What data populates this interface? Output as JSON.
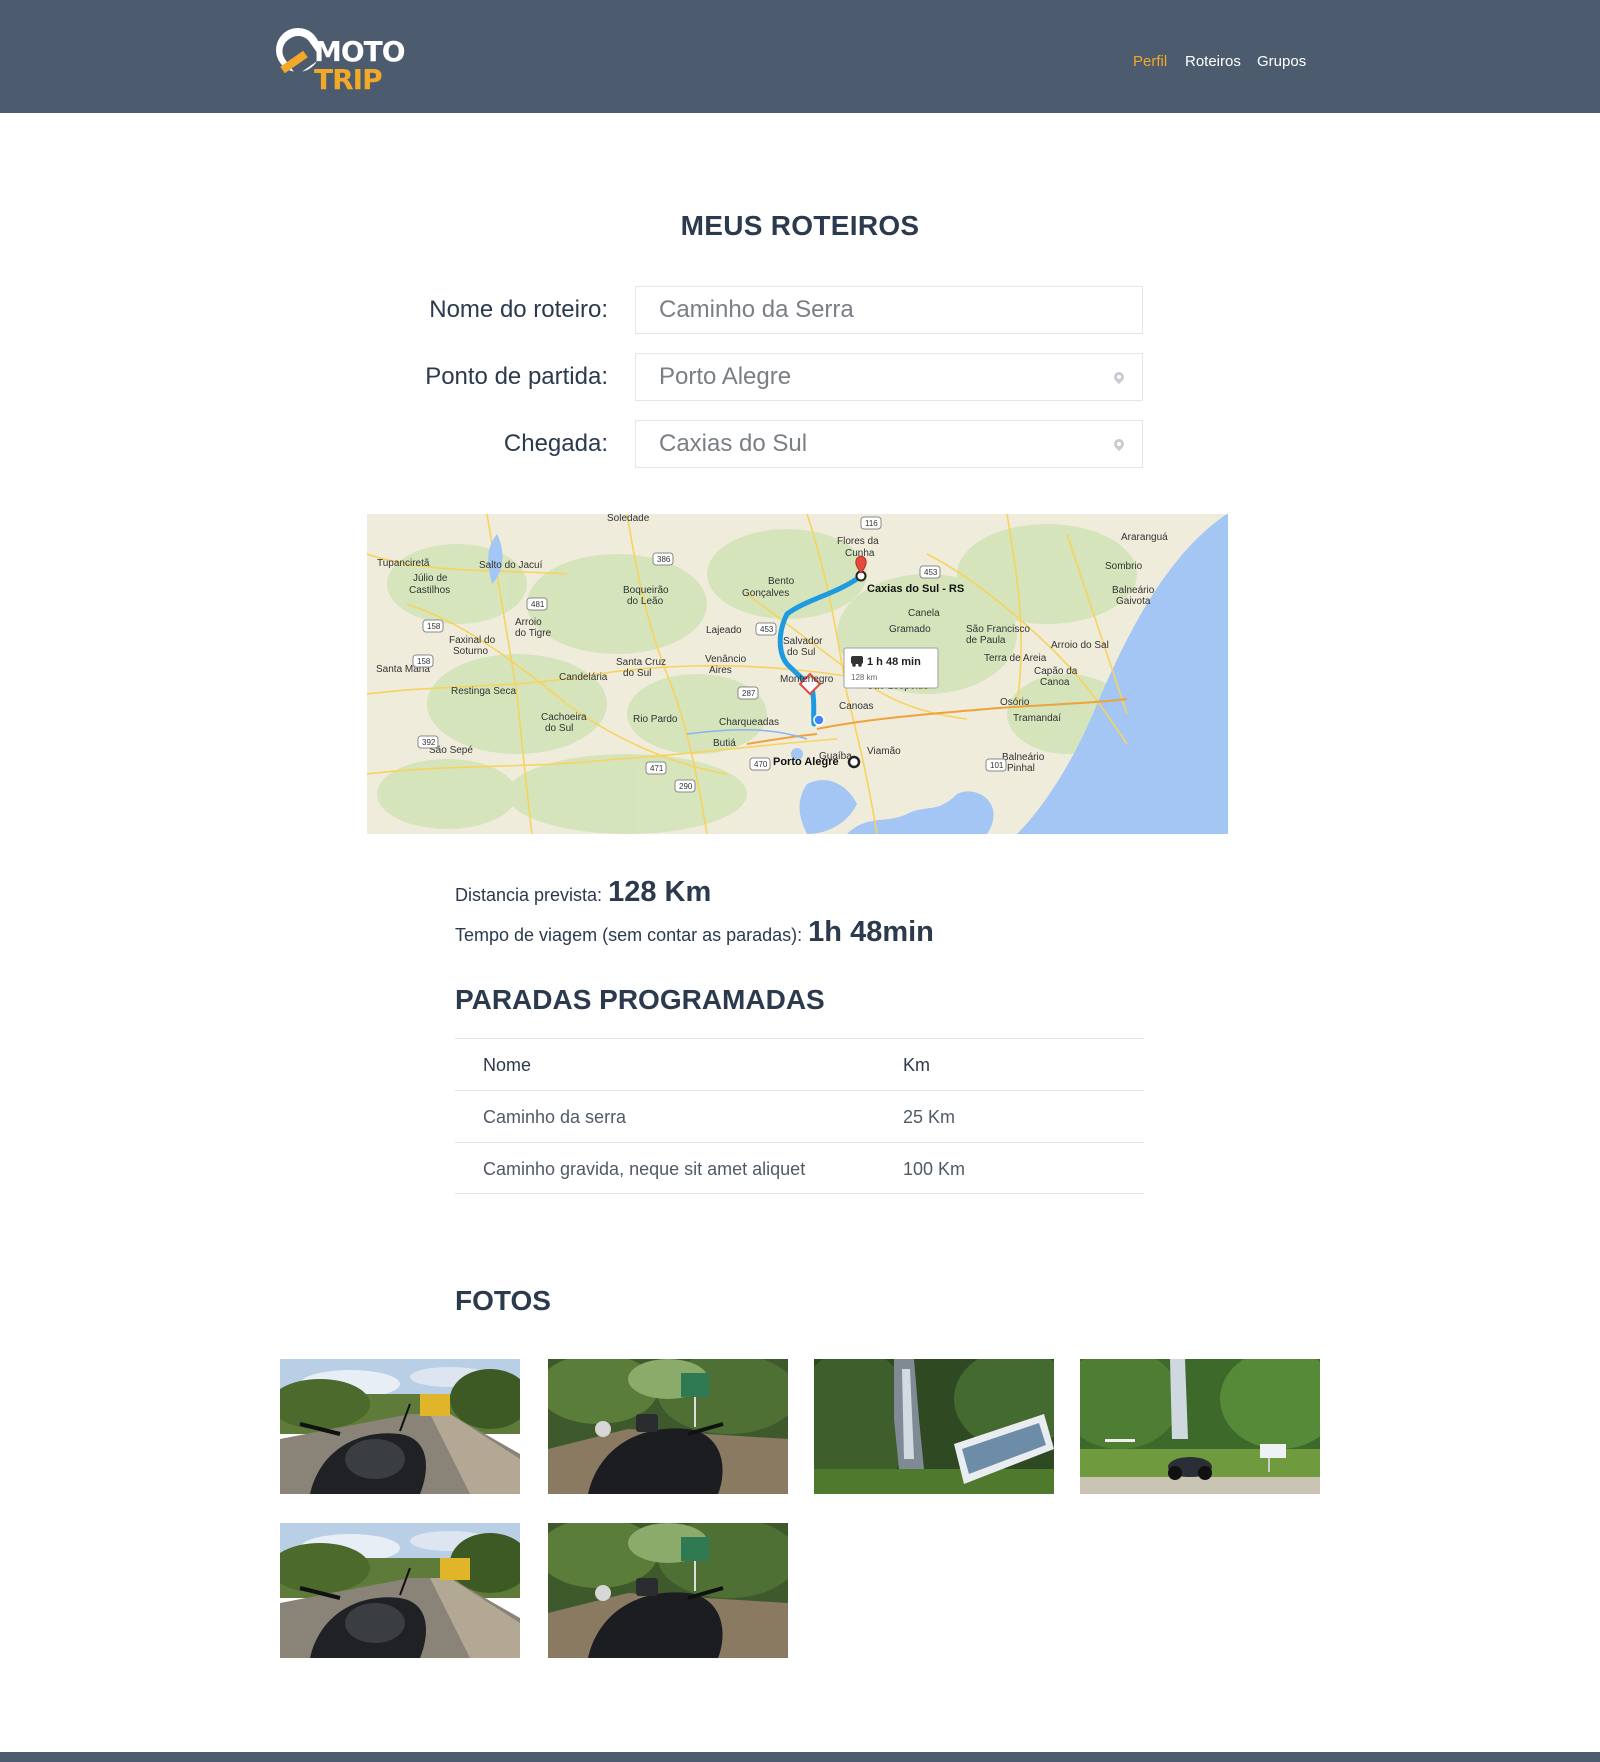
{
  "header": {
    "logo_top": "MOTO",
    "logo_bottom": "TRIP",
    "nav": [
      {
        "label": "Perfil",
        "active": true
      },
      {
        "label": "Roteiros",
        "active": false
      },
      {
        "label": "Grupos",
        "active": false
      }
    ]
  },
  "page_title": "MEUS ROTEIROS",
  "form": {
    "route_name_label": "Nome do roteiro:",
    "route_name_value": "Caminho da Serra",
    "start_label": "Ponto de partida:",
    "start_value": "Porto Alegre",
    "end_label": "Chegada:",
    "end_value": "Caxias do Sul"
  },
  "map": {
    "destination_label": "Caxias do Sul - RS",
    "origin_label": "Porto Alegre",
    "route_duration": "1 h 48 min",
    "route_distance": "128 km",
    "places": [
      "Soledade",
      "Flores da Cunha",
      "Araranguá",
      "Tupanciretã",
      "Salto do Jacuí",
      "Júlio de Castilhos",
      "Bento Gonçalves",
      "Boqueirão do Leão",
      "Sombrio",
      "Balneário Gaivota",
      "Canela",
      "Gramado",
      "São Francisco de Paula",
      "Arroio do Tigre",
      "Lajeado",
      "Salvador do Sul",
      "Faxinal do Soturno",
      "Santa Cruz do Sul",
      "Venâncio Aires",
      "Terra de Areia",
      "Arroio do Sal",
      "Santa Maria",
      "Candelária",
      "Montenegro",
      "Capão da Canoa",
      "Restinga Seca",
      "São Leopoldo",
      "Canoas",
      "Osório",
      "Cachoeira do Sul",
      "Rio Pardo",
      "Charqueadas",
      "Tramandaí",
      "Butiá",
      "Viamão",
      "Guaíba",
      "São Sepé",
      "Balneário Pinhal"
    ],
    "road_numbers": [
      "116",
      "386",
      "453",
      "481",
      "158",
      "453",
      "158",
      "287",
      "392",
      "471",
      "470",
      "290",
      "101"
    ]
  },
  "stats": {
    "distance_label": "Distancia prevista:",
    "distance_value": "128 Km",
    "time_label": "Tempo de viagem (sem contar as paradas):",
    "time_value": "1h 48min"
  },
  "stops": {
    "title": "PARADAS PROGRAMADAS",
    "columns": [
      "Nome",
      "Km"
    ],
    "rows": [
      {
        "name": "Caminho da serra",
        "km": "25 Km"
      },
      {
        "name": "Caminho gravida, neque sit amet aliquet",
        "km": "100 Km"
      }
    ]
  },
  "photos": {
    "title": "FOTOS",
    "items": [
      {
        "scene": "motorcycle-road"
      },
      {
        "scene": "motorcycle-forest-sign"
      },
      {
        "scene": "waterfall-sign"
      },
      {
        "scene": "waterfall-motorcycle"
      },
      {
        "scene": "motorcycle-road"
      },
      {
        "scene": "motorcycle-forest-sign"
      }
    ]
  },
  "colors": {
    "header_bg": "#4d5b6e",
    "accent": "#f2a828",
    "text_dark": "#2b3a4d",
    "route_blue": "#1e9be0",
    "sea_blue": "#a4c6f4"
  }
}
